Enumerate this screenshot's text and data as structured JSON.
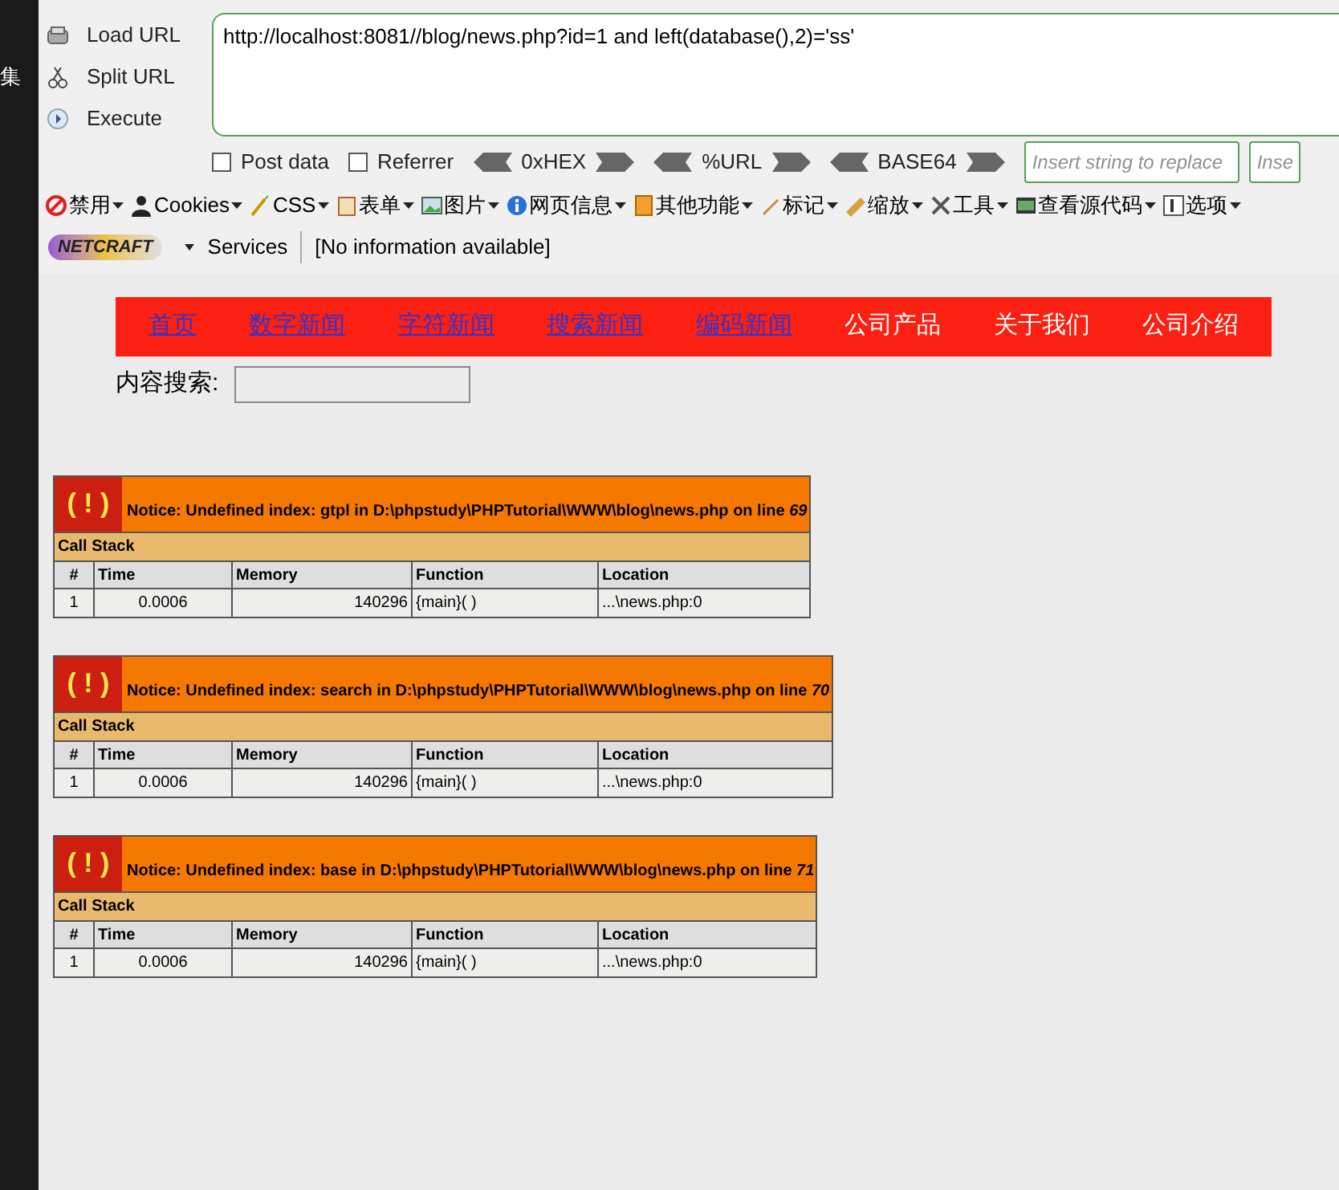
{
  "side_strip": {
    "text": "集"
  },
  "hackbar": {
    "buttons": [
      {
        "label": "Load URL",
        "kind": "load"
      },
      {
        "label": "Split URL",
        "kind": "split"
      },
      {
        "label": "Execute",
        "kind": "execute"
      }
    ],
    "url": "http://localhost:8081//blog/news.php?id=1 and left(database(),2)='ss'",
    "options": [
      {
        "label": "Post data",
        "checked": false
      },
      {
        "label": "Referrer",
        "checked": false
      }
    ],
    "encoders": [
      "0xHEX",
      "%URL",
      "BASE64"
    ],
    "replace_fields": [
      {
        "placeholder": "Insert string to replace"
      },
      {
        "placeholder": "Inse"
      }
    ]
  },
  "toolbar": {
    "menus": [
      {
        "label": "禁用",
        "kind": "disable"
      },
      {
        "label": "Cookies",
        "kind": "cookie"
      },
      {
        "label": "CSS",
        "kind": "css"
      },
      {
        "label": "表单",
        "kind": "form"
      },
      {
        "label": "图片",
        "kind": "image"
      },
      {
        "label": "网页信息",
        "kind": "info"
      },
      {
        "label": "其他功能",
        "kind": "misc"
      },
      {
        "label": "标记",
        "kind": "pen"
      },
      {
        "label": "缩放",
        "kind": "ruler"
      },
      {
        "label": "工具",
        "kind": "tools"
      },
      {
        "label": "查看源代码",
        "kind": "source"
      },
      {
        "label": "选项",
        "kind": "options"
      }
    ]
  },
  "netcraft": {
    "logo": "NETCRAFT",
    "services": "Services",
    "info": "[No information available]"
  },
  "page": {
    "nav": [
      {
        "label": "首页",
        "link": true
      },
      {
        "label": "数字新闻",
        "link": true
      },
      {
        "label": "字符新闻",
        "link": true
      },
      {
        "label": "搜索新闻",
        "link": true
      },
      {
        "label": "编码新闻",
        "link": true
      },
      {
        "label": "公司产品",
        "link": false
      },
      {
        "label": "关于我们",
        "link": false
      },
      {
        "label": "公司介绍",
        "link": false
      }
    ],
    "search": {
      "label": "内容搜索:"
    },
    "errors": [
      {
        "icon": "( ! )",
        "message": "Notice: Undefined index: gtpl in D:\\phpstudy\\PHPTutorial\\WWW\\blog\\news.php on line *69*",
        "call_stack": "Call Stack",
        "columns": [
          "#",
          "Time",
          "Memory",
          "Function",
          "Location"
        ],
        "rows": [
          [
            "1",
            "0.0006",
            "140296",
            "{main}( )",
            "...\\news.php:0"
          ]
        ]
      },
      {
        "icon": "( ! )",
        "message": "Notice: Undefined index: search in D:\\phpstudy\\PHPTutorial\\WWW\\blog\\news.php on line *70*",
        "call_stack": "Call Stack",
        "columns": [
          "#",
          "Time",
          "Memory",
          "Function",
          "Location"
        ],
        "rows": [
          [
            "1",
            "0.0006",
            "140296",
            "{main}( )",
            "...\\news.php:0"
          ]
        ]
      },
      {
        "icon": "( ! )",
        "message": "Notice: Undefined index: base in D:\\phpstudy\\PHPTutorial\\WWW\\blog\\news.php on line *71*",
        "call_stack": "Call Stack",
        "columns": [
          "#",
          "Time",
          "Memory",
          "Function",
          "Location"
        ],
        "rows": [
          [
            "1",
            "0.0006",
            "140296",
            "{main}( )",
            "...\\news.php:0"
          ]
        ]
      }
    ]
  }
}
